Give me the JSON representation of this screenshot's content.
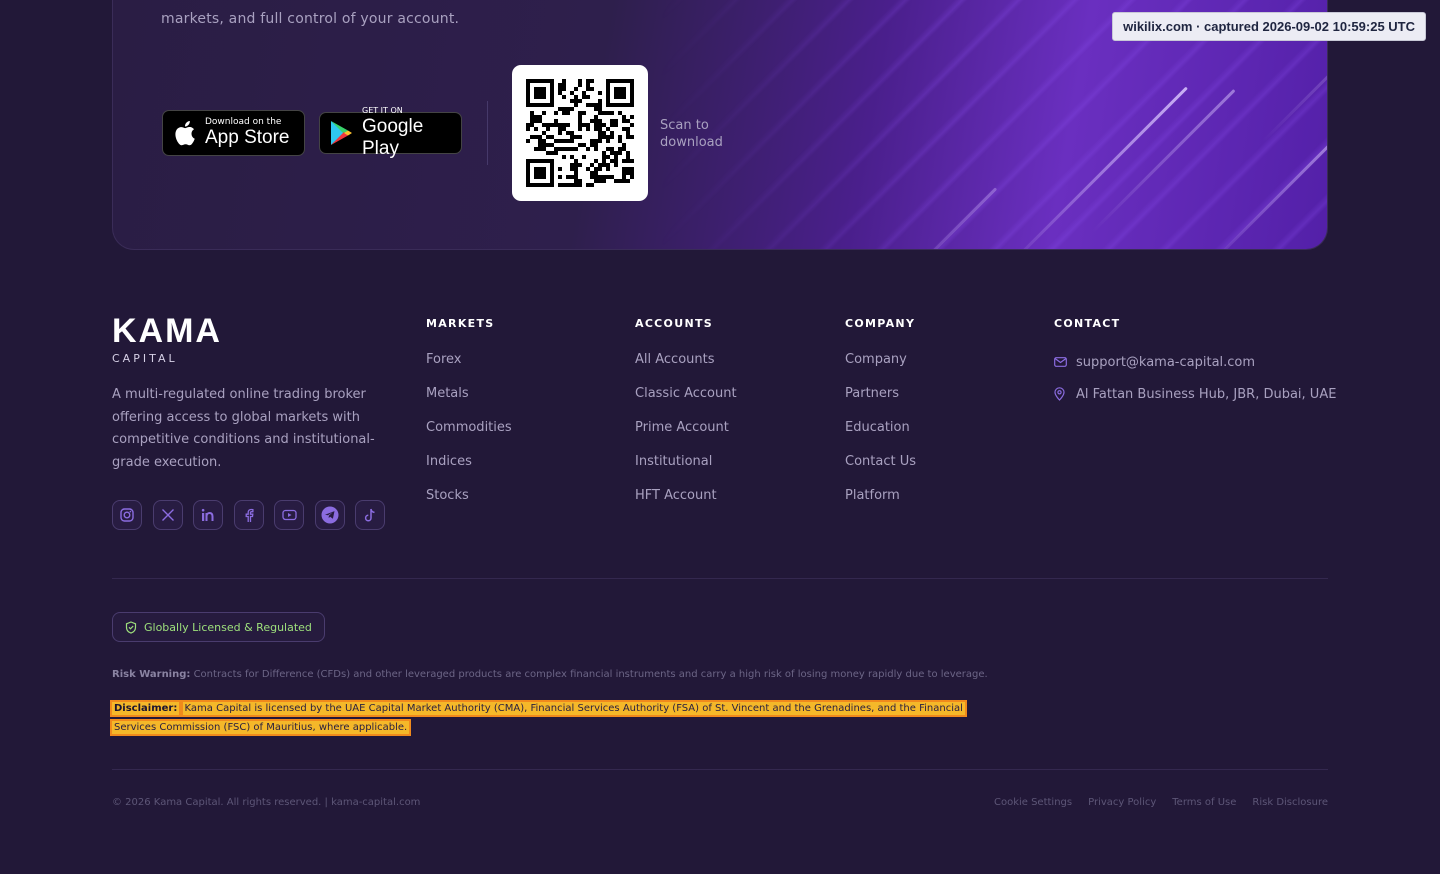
{
  "banner": {
    "text": "markets, and full control of your account.",
    "app_store": {
      "small": "Download on the",
      "big": "App Store"
    },
    "google_play": {
      "small": "GET IT ON",
      "big": "Google Play"
    },
    "scan_text": "Scan to download"
  },
  "watermark": "wikilix.com · captured 2026-09-02 10:59:25 UTC",
  "brand": {
    "name": "KAMA",
    "sub": "CAPITAL"
  },
  "about": "A multi-regulated online trading broker offering access to global markets with competitive conditions and institutional-grade execution.",
  "socials": [
    "instagram-icon",
    "x-icon",
    "linkedin-icon",
    "facebook-icon",
    "youtube-icon",
    "telegram-icon",
    "tiktok-icon"
  ],
  "columns": [
    {
      "title": "MARKETS",
      "links": [
        "Forex",
        "Metals",
        "Commodities",
        "Indices",
        "Stocks"
      ]
    },
    {
      "title": "ACCOUNTS",
      "links": [
        "All Accounts",
        "Classic Account",
        "Prime Account",
        "Institutional",
        "HFT Account"
      ]
    },
    {
      "title": "COMPANY",
      "links": [
        "Company",
        "Partners",
        "Education",
        "Contact Us",
        "Platform"
      ]
    }
  ],
  "contact": {
    "title": "CONTACT",
    "email": "support@kama-capital.com",
    "address": "Al Fattan Business Hub, JBR, Dubai, UAE"
  },
  "badge": "Globally Licensed & Regulated",
  "risk": {
    "label": "Risk Warning:",
    "text": "Contracts for Difference (CFDs) and other leveraged products are complex financial instruments and carry a high risk of losing money rapidly due to leverage."
  },
  "disclaimer": {
    "label": "Disclaimer:",
    "text": "Kama Capital is licensed by the UAE Capital Market Authority (CMA), Financial Services Authority (FSA) of St. Vincent and the Grenadines, and the Financial Services Commission (FSC) of Mauritius, where applicable."
  },
  "copyright": "© 2026 Kama Capital. All rights reserved. | kama-capital.com",
  "legal_links": [
    "Cookie Settings",
    "Privacy Policy",
    "Terms of Use",
    "Risk Disclosure"
  ],
  "colors": {
    "background": "#221838",
    "accent": "#8b6ce0",
    "badge_green": "#9ee07c",
    "highlight": "#f5b829"
  }
}
